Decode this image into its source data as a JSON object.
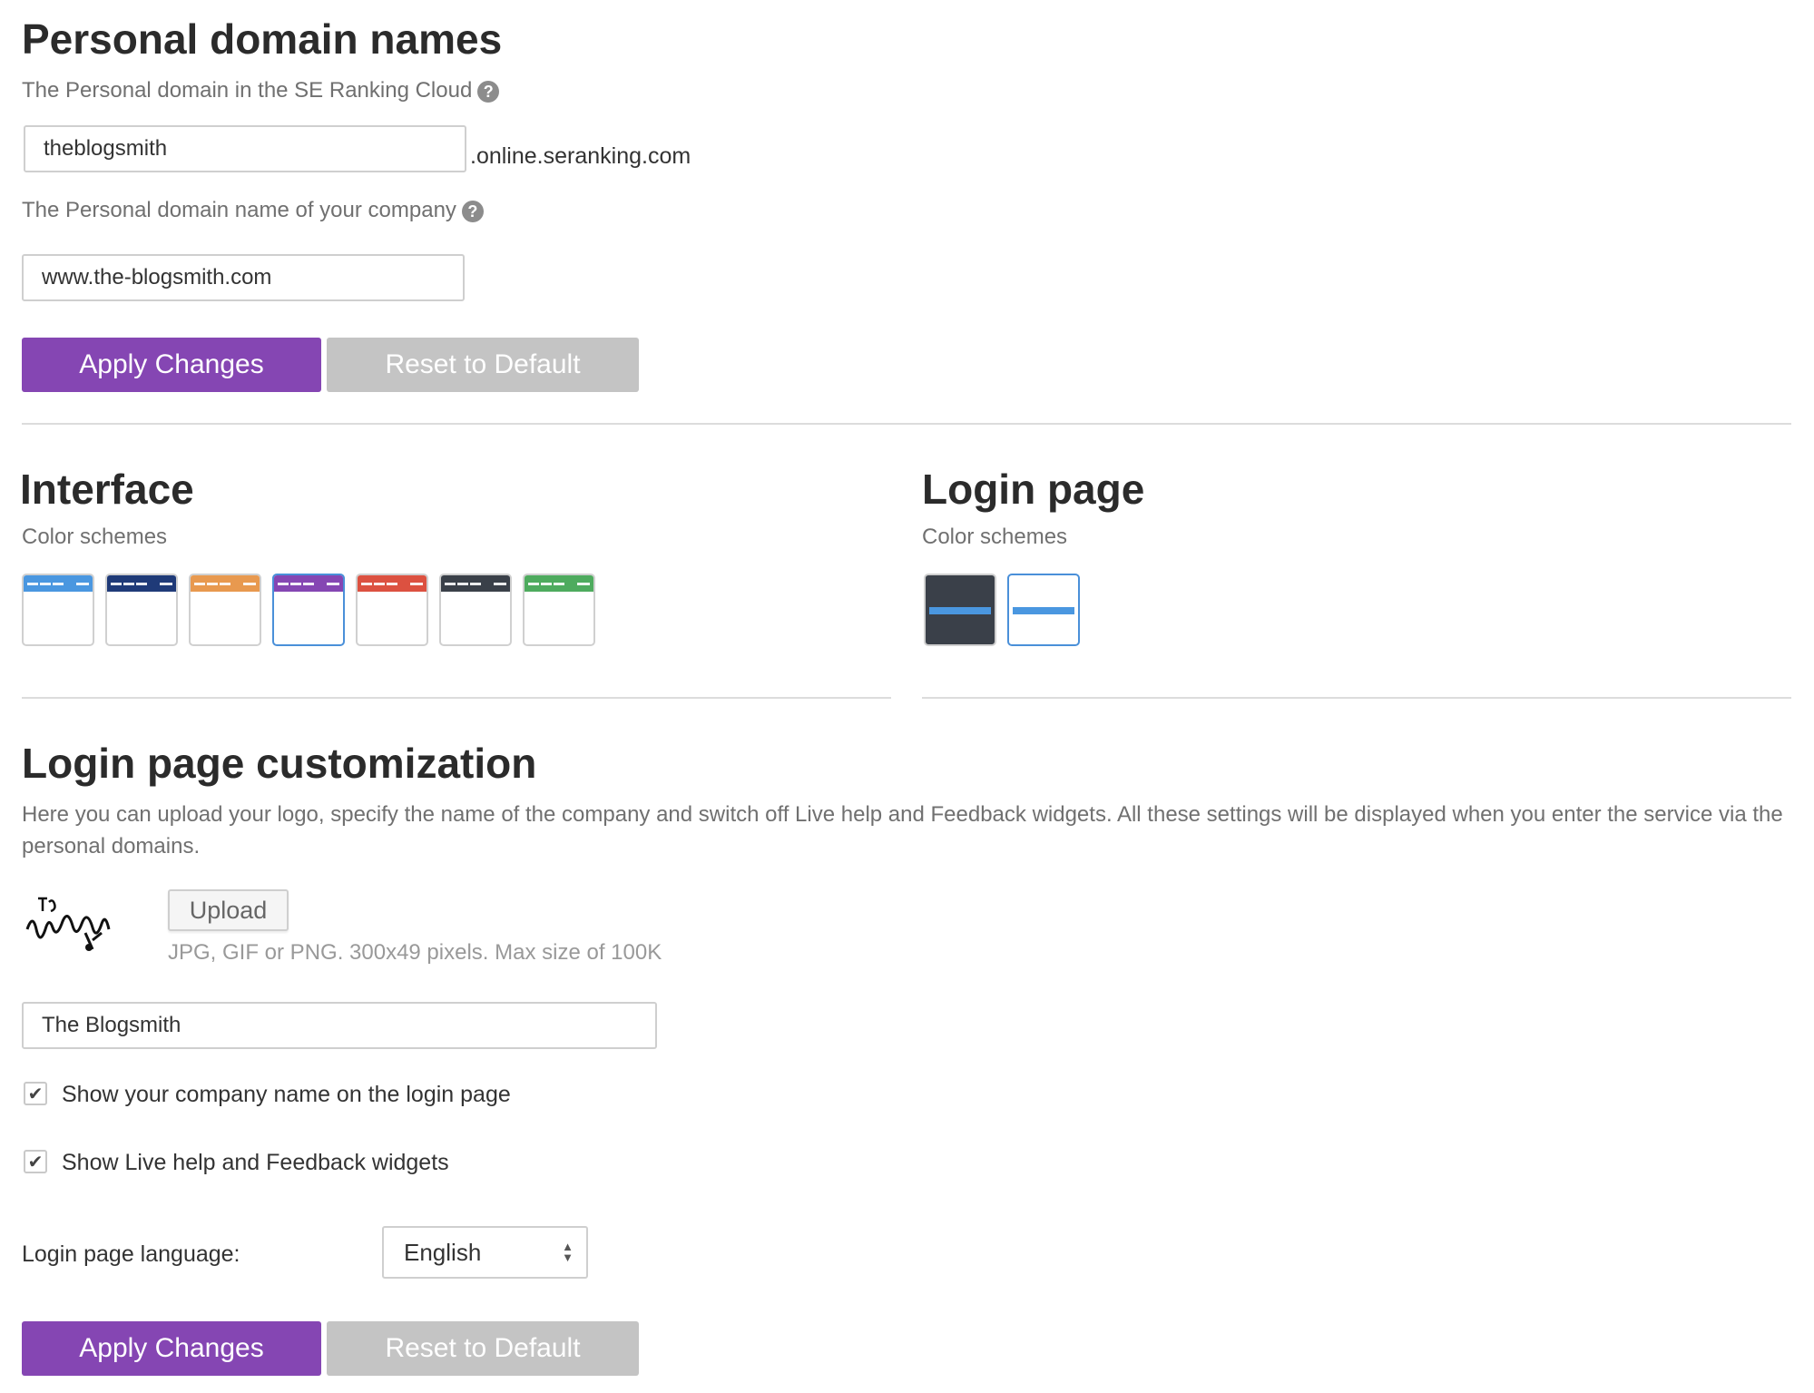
{
  "personal_domains": {
    "title": "Personal domain names",
    "cloud_label": "The Personal domain in the SE Ranking Cloud",
    "subdomain_value": "theblogsmith",
    "subdomain_suffix": ".online.seranking.com",
    "company_label": "The Personal domain name of your company",
    "company_domain_value": "www.the-blogsmith.com",
    "help_glyph": "?",
    "apply_label": "Apply Changes",
    "reset_label": "Reset to Default"
  },
  "interface": {
    "title": "Interface",
    "schemes_label": "Color schemes",
    "schemes": [
      {
        "color": "#4a97e0",
        "selected": false
      },
      {
        "color": "#1f3a78",
        "selected": false
      },
      {
        "color": "#e8994f",
        "selected": false
      },
      {
        "color": "#8546b3",
        "selected": true
      },
      {
        "color": "#dc5140",
        "selected": false
      },
      {
        "color": "#3a4049",
        "selected": false
      },
      {
        "color": "#4eab5e",
        "selected": false
      }
    ]
  },
  "login_page": {
    "title": "Login page",
    "schemes_label": "Color schemes",
    "schemes": [
      {
        "background": "#3a4049",
        "stripe": "#4a97e0",
        "selected": false
      },
      {
        "background": "#ffffff",
        "stripe": "#4a97e0",
        "selected": true
      }
    ]
  },
  "customization": {
    "title": "Login page customization",
    "description": "Here you can upload your logo, specify the name of the company and switch off Live help and Feedback widgets. All these settings will be displayed when you enter the service via the personal domains.",
    "logo_text": "The Blogsmith",
    "upload_label": "Upload",
    "upload_hint": "JPG, GIF or PNG. 300x49 pixels. Max size of 100K",
    "company_name_value": "The Blogsmith",
    "checkbox_company_name": {
      "label": "Show your company name on the login page",
      "checked": true
    },
    "checkbox_widgets": {
      "label": "Show Live help and Feedback widgets",
      "checked": true
    },
    "check_glyph": "✔",
    "language_label": "Login page language:",
    "language_value": "English",
    "apply_label": "Apply Changes",
    "reset_label": "Reset to Default"
  },
  "colors": {
    "primary": "#8546b3",
    "secondary": "#c4c4c4",
    "selected_border": "#4a90d9"
  }
}
